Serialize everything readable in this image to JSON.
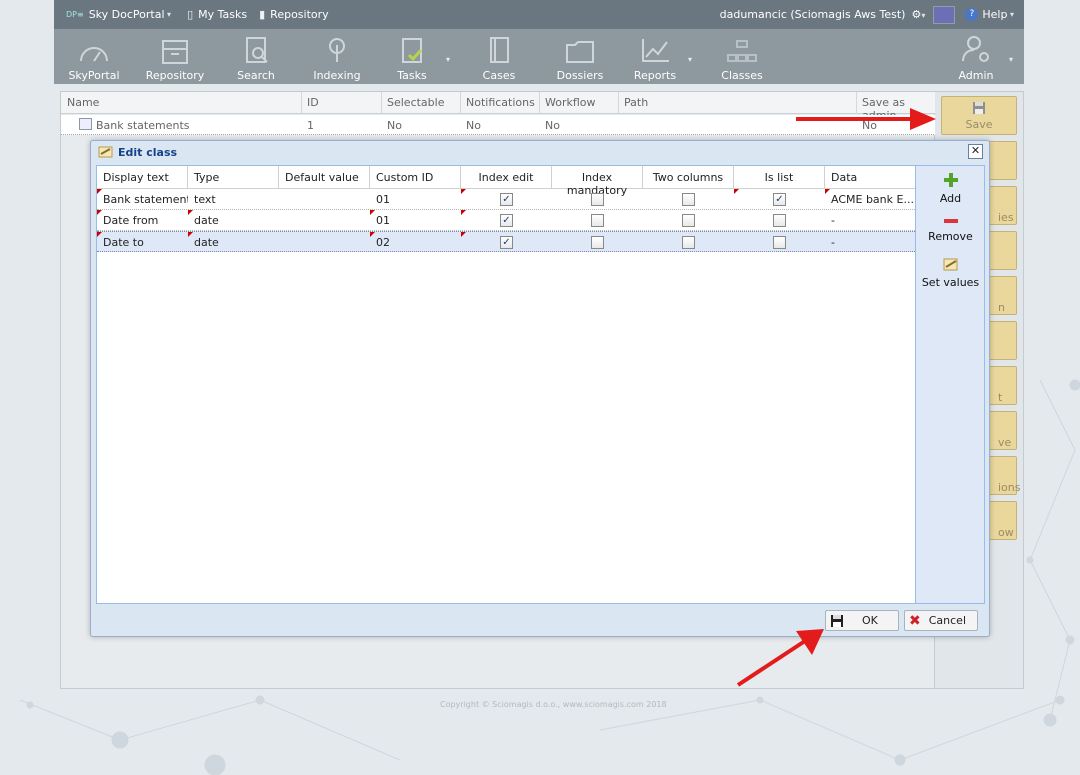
{
  "topbar": {
    "brand": "Sky DocPortal",
    "my_tasks": "My Tasks",
    "repository": "Repository",
    "user": "dadumancic (Sciomagis Aws Test)",
    "help": "Help"
  },
  "toolbar": {
    "items": [
      {
        "label": "SkyPortal"
      },
      {
        "label": "Repository"
      },
      {
        "label": "Search"
      },
      {
        "label": "Indexing"
      },
      {
        "label": "Tasks"
      },
      {
        "label": "Cases"
      },
      {
        "label": "Dossiers"
      },
      {
        "label": "Reports"
      },
      {
        "label": "Classes"
      },
      {
        "label": "Admin"
      }
    ]
  },
  "classes_grid": {
    "columns": [
      "Name",
      "ID",
      "Selectable",
      "Notifications",
      "Workflow",
      "Path",
      "Save as admin."
    ],
    "rows": [
      {
        "name": "Bank statements",
        "id": "1",
        "selectable": "No",
        "notifications": "No",
        "workflow": "No",
        "path": "",
        "save_as_admin": "No"
      }
    ]
  },
  "side": {
    "save_label": "Save",
    "partial_labels": [
      "ies",
      "n",
      "t",
      "ve",
      "ions",
      "ow"
    ]
  },
  "dialog": {
    "title": "Edit class",
    "columns": [
      "Display text",
      "Type",
      "Default value",
      "Custom ID",
      "Index edit",
      "Index mandatory",
      "Two columns",
      "Is list",
      "Data"
    ],
    "rows": [
      {
        "display_text": "Bank statement",
        "type": "text",
        "default_value": "",
        "custom_id": "01",
        "index_edit": true,
        "index_mandatory": false,
        "two_columns": false,
        "is_list": true,
        "data": "ACME bank E..."
      },
      {
        "display_text": "Date from",
        "type": "date",
        "default_value": "",
        "custom_id": "01",
        "index_edit": true,
        "index_mandatory": false,
        "two_columns": false,
        "is_list": false,
        "data": "-"
      },
      {
        "display_text": "Date to",
        "type": "date",
        "default_value": "",
        "custom_id": "02",
        "index_edit": true,
        "index_mandatory": false,
        "two_columns": false,
        "is_list": false,
        "data": "-"
      }
    ],
    "actions": {
      "add": "Add",
      "remove": "Remove",
      "set_values": "Set values"
    },
    "ok_label": "OK",
    "cancel_label": "Cancel"
  },
  "footer": "Copyright © Sciomagis d.o.o., www.sciomagis.com 2018",
  "colors": {
    "accent_arrow": "#e31b1b",
    "topbar": "#6a7680",
    "toolbar": "#8e999f",
    "save_button": "#ead79c"
  }
}
